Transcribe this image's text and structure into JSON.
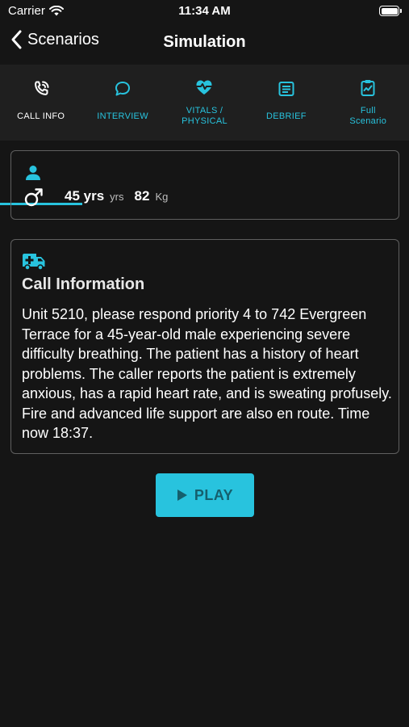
{
  "status": {
    "carrier": "Carrier",
    "time": "11:34 AM"
  },
  "nav": {
    "back_label": "Scenarios",
    "title": "Simulation"
  },
  "tabs": [
    {
      "label": "CALL INFO",
      "icon": "phone-call-icon",
      "active": true
    },
    {
      "label": "INTERVIEW",
      "icon": "chat-bubble-icon",
      "active": false
    },
    {
      "label": "VITALS /\nPHYSICAL",
      "icon": "heart-pulse-icon",
      "active": false
    },
    {
      "label": "DEBRIEF",
      "icon": "document-list-icon",
      "active": false
    },
    {
      "label": "Full\nScenario",
      "icon": "clipboard-chart-icon",
      "active": false
    }
  ],
  "patient": {
    "age_value": "45 yrs",
    "age_unit": "yrs",
    "weight_value": "82",
    "weight_unit": "Kg",
    "sex": "male"
  },
  "call": {
    "title": "Call Information",
    "text": "Unit 5210, please respond priority 4 to 742 Evergreen Terrace for a 45-year-old male experiencing severe difficulty breathing. The patient has a history of heart problems. The caller reports the patient is extremely anxious, has a rapid heart rate, and is sweating profusely. Fire and advanced life support are also en route. Time now 18:37."
  },
  "play": {
    "label": "PLAY"
  },
  "colors": {
    "accent": "#28c3de",
    "background": "#151515",
    "tab_bar": "#1f1f1f",
    "card_border": "#5f5f5f"
  }
}
